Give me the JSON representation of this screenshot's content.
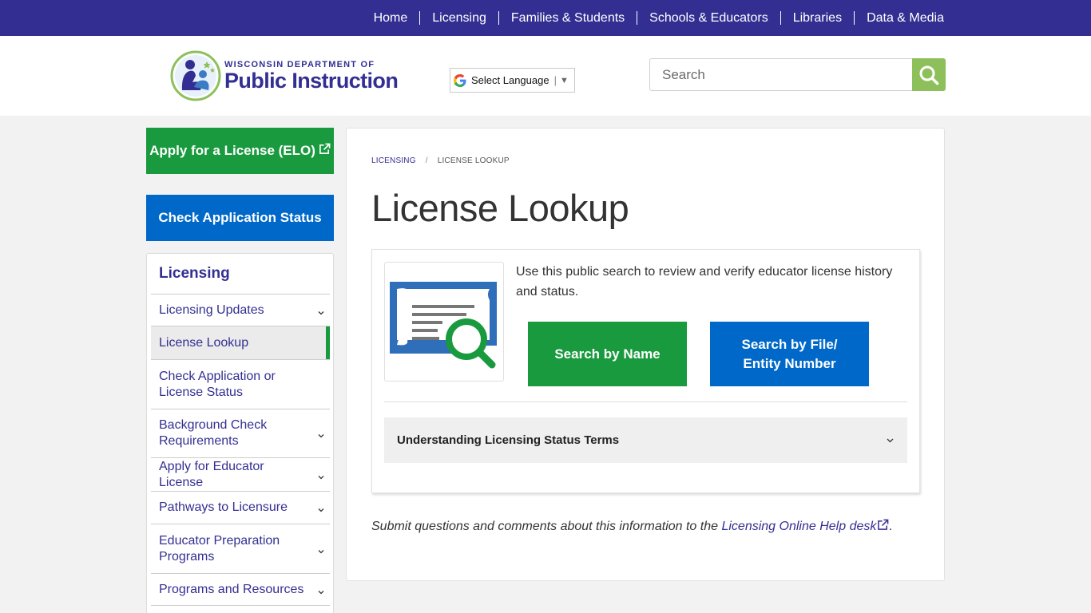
{
  "topnav": {
    "items": [
      "Home",
      "Licensing",
      "Families & Students",
      "Schools & Educators",
      "Libraries",
      "Data & Media"
    ]
  },
  "header": {
    "logo_line1": "WISCONSIN DEPARTMENT OF",
    "logo_line2": "Public Instruction",
    "language_label": "Select Language",
    "language_arrow": "▼",
    "search_placeholder": "Search"
  },
  "sidebar": {
    "apply_label": "Apply for a License (ELO)",
    "status_label": "Check Application Status",
    "nav_title": "Licensing",
    "items": [
      {
        "label": "Licensing Updates",
        "expandable": true
      },
      {
        "label": "License Lookup",
        "active": true
      },
      {
        "label": "Check Application or License Status"
      },
      {
        "label": "Background Check Requirements",
        "expandable": true
      },
      {
        "label": "Apply for Educator License",
        "expandable": true
      },
      {
        "label": "Pathways to Licensure",
        "expandable": true
      },
      {
        "label": "Educator Preparation Programs",
        "expandable": true
      },
      {
        "label": "Programs and Resources",
        "expandable": true
      }
    ]
  },
  "main": {
    "breadcrumb": [
      "LICENSING",
      "LICENSE LOOKUP"
    ],
    "breadcrumb_divider": "/",
    "title": "License Lookup",
    "description": "Use this public search to review and verify educator license history and status.",
    "search_by_name": "Search by Name",
    "search_by_file": "Search by File/ Entity Number",
    "accordion_label": "Understanding Licensing Status Terms",
    "footnote_prefix": "Submit questions and comments about this information to the ",
    "footnote_link": "Licensing Online Help desk",
    "footnote_suffix": "."
  },
  "colors": {
    "brand_purple": "#332f92",
    "green": "#1a9a3e",
    "blue": "#0068c9",
    "search_green": "#8dc05a"
  }
}
